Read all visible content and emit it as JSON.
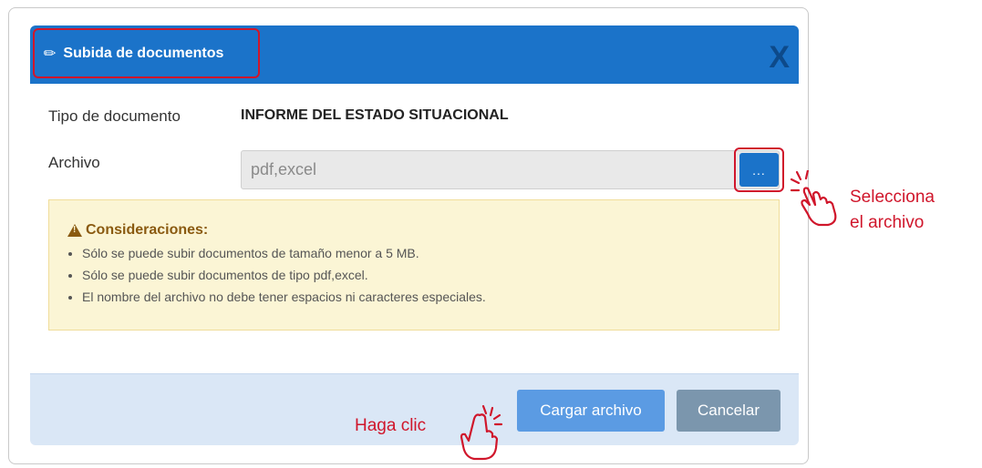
{
  "dialog": {
    "title": "Subida de documentos",
    "close_label": "X",
    "tipo_label": "Tipo de documento",
    "tipo_value": "INFORME DEL ESTADO SITUACIONAL",
    "archivo_label": "Archivo",
    "archivo_placeholder": "pdf,excel",
    "browse_label": "...",
    "considerations": {
      "title": "Consideraciones:",
      "items": [
        "Sólo se puede subir documentos de tamaño menor a 5 MB.",
        "Sólo se puede subir documentos de tipo pdf,excel.",
        "El nombre del archivo no debe tener espacios ni caracteres especiales."
      ]
    },
    "footer": {
      "upload_label": "Cargar archivo",
      "cancel_label": "Cancelar"
    }
  },
  "annotations": {
    "select_line1": "Selecciona",
    "select_line2": "el archivo",
    "click_note": "Haga clic"
  },
  "icons": {
    "title": "paperclip-icon",
    "warning": "warning-icon",
    "hand": "hand-pointer-icon"
  },
  "colors": {
    "primary": "#1b73c9",
    "highlight": "#d0162b",
    "alert_bg": "#fbf5d5",
    "footer_bg": "#dae7f6"
  }
}
